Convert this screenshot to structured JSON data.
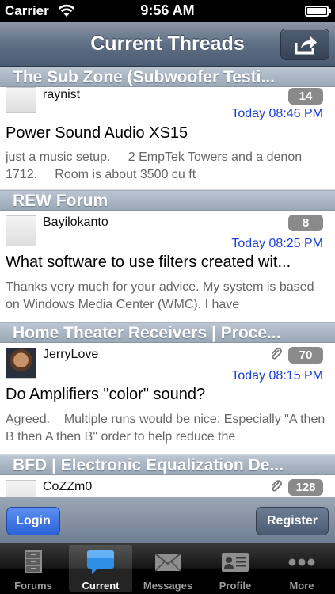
{
  "status_bar": {
    "carrier": "Carrier",
    "time": "9:56 AM"
  },
  "nav": {
    "title": "Current Threads"
  },
  "sections": [
    {
      "header": "The Sub Zone (Subwoofer Testi...",
      "thread": {
        "user": "raynist",
        "count": "14",
        "date": "Today 08:46 PM",
        "title": "Power Sound Audio XS15",
        "snippet": "just a music setup.     2 EmpTek Towers and a denon 1712.     Room is about 3500 cu ft",
        "attachment": false
      }
    },
    {
      "header": "REW Forum",
      "thread": {
        "user": "Bayilokanto",
        "count": "8",
        "date": "Today 08:25 PM",
        "title": "What software to use filters created wit...",
        "snippet": "Thanks very much for your advice. My system is based on Windows Media Center (WMC). I have",
        "attachment": false
      }
    },
    {
      "header": "Home Theater Receivers | Proce...",
      "thread": {
        "user": "JerryLove",
        "count": "70",
        "date": "Today 08:15 PM",
        "title": "Do Amplifiers \"color\" sound?",
        "snippet": "Agreed.    Multiple runs would be nice: Especially \"A then B then A then B\" order to help reduce the",
        "attachment": true
      }
    },
    {
      "header": "BFD | Electronic Equalization De...",
      "thread": {
        "user": "CoZZm0",
        "count": "128",
        "attachment": true
      }
    }
  ],
  "toolbar": {
    "login_label": "Login",
    "register_label": "Register"
  },
  "tabs": [
    {
      "label": "Forums",
      "icon": "cabinet-icon",
      "active": false
    },
    {
      "label": "Current",
      "icon": "speech-bubble-icon",
      "active": true
    },
    {
      "label": "Messages",
      "icon": "envelope-icon",
      "active": false
    },
    {
      "label": "Profile",
      "icon": "id-card-icon",
      "active": false
    },
    {
      "label": "More",
      "icon": "more-dots-icon",
      "active": false
    }
  ]
}
